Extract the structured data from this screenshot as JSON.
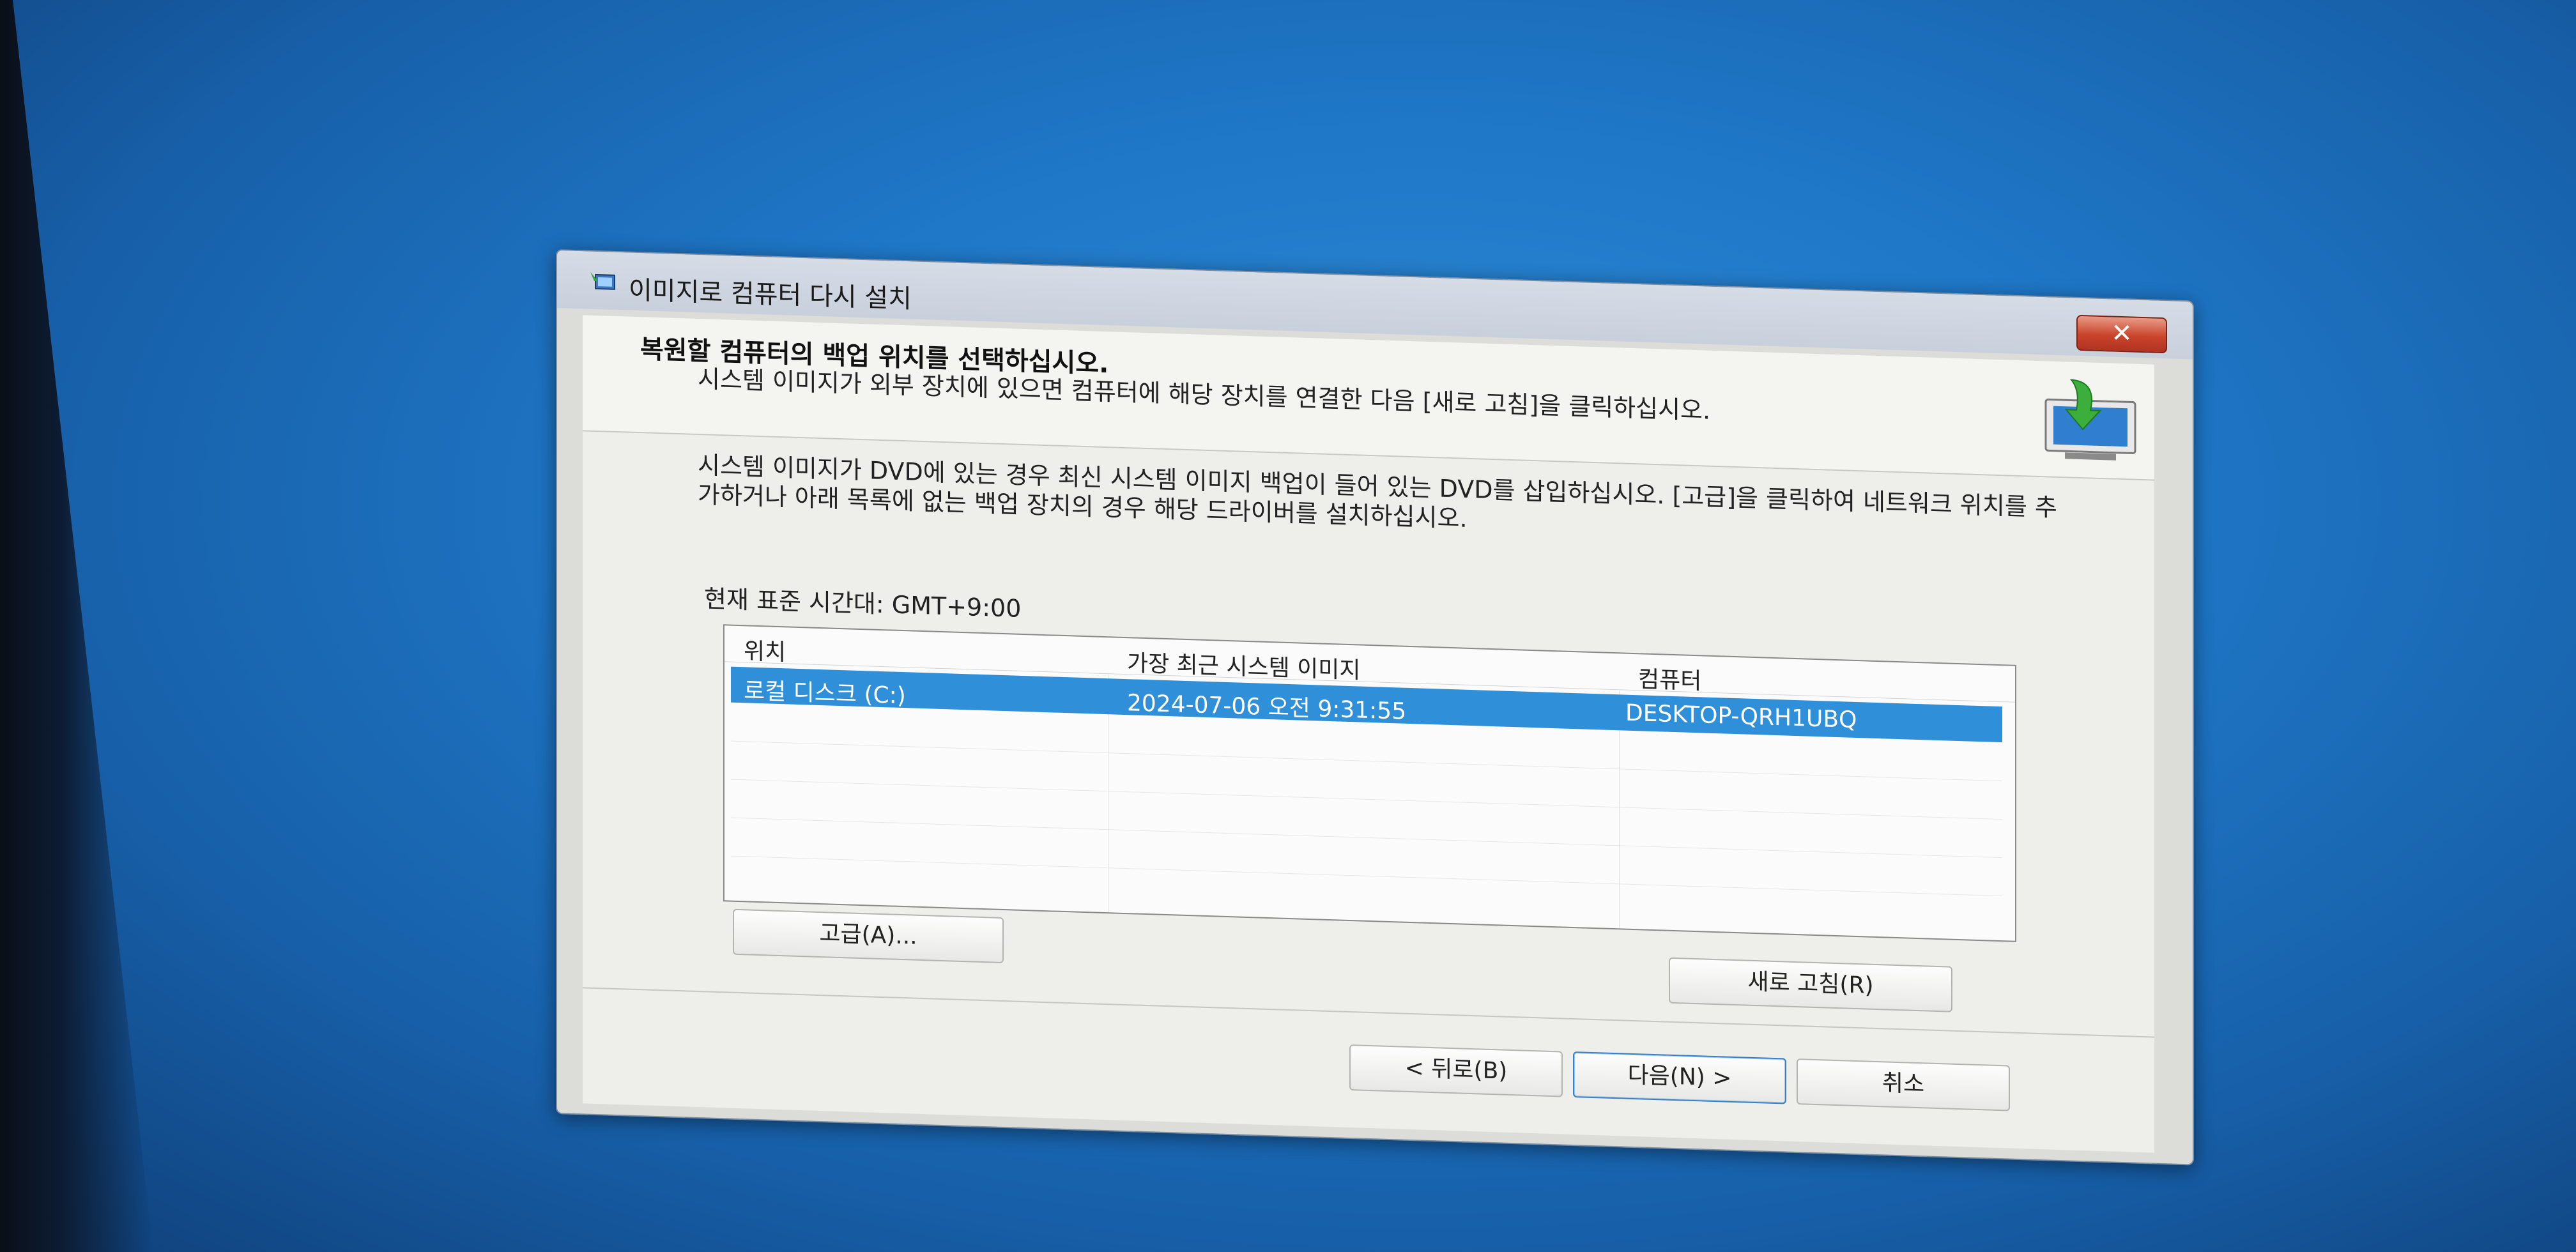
{
  "window": {
    "title": "이미지로 컴퓨터 다시 설치",
    "close_label": "✕"
  },
  "header": {
    "heading": "복원할 컴퓨터의 백업 위치를 선택하십시오.",
    "subheading": "시스템 이미지가 외부 장치에 있으면 컴퓨터에 해당 장치를 연결한 다음 [새로 고침]을 클릭하십시오."
  },
  "content": {
    "intro": "시스템 이미지가 DVD에 있는 경우 최신 시스템 이미지 백업이 들어 있는 DVD를 삽입하십시오. [고급]을 클릭하여 네트워크 위치를 추가하거나 아래 목록에 없는 백업 장치의 경우 해당 드라이버를 설치하십시오.",
    "timezone": "현재 표준 시간대: GMT+9:00"
  },
  "table": {
    "columns": [
      "위치",
      "가장 최근 시스템 이미지",
      "컴퓨터"
    ],
    "rows": [
      {
        "location": "로컬 디스크 (C:)",
        "date": "2024-07-06 오전 9:31:55",
        "computer": "DESKTOP-QRH1UBQ",
        "selected": true
      }
    ]
  },
  "buttons": {
    "advanced": "고급(A)...",
    "refresh": "새로 고침(R)",
    "back": "< 뒤로(B)",
    "next": "다음(N) >",
    "cancel": "취소"
  },
  "icons": {
    "app": "restore-image-icon",
    "header": "backup-restore-monitor-icon",
    "close": "close-icon"
  },
  "colors": {
    "desktop": "#1f78c8",
    "selection": "#2f8fd8",
    "close_button": "#c9442b"
  }
}
